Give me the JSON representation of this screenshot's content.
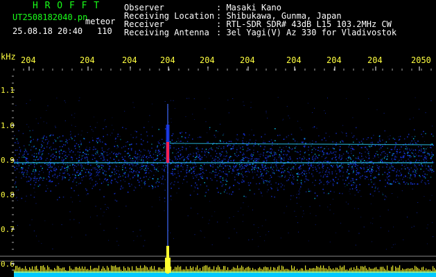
{
  "header": {
    "brand": "H R O F F T",
    "file_name": "UT2508182040.pn",
    "mode": "meteor",
    "datetime": "25.08.18 20:40",
    "count": "110"
  },
  "info": {
    "labels": [
      "Observer",
      "Receiving Location",
      "Receiver",
      "Receiving Antenna"
    ],
    "values": [
      ": Masaki Kano",
      ": Shibukawa, Gunma, Japan",
      ": RTL-SDR SDR# 43dB L15 103.2MHz CW",
      ": 3el Yagi(V) Az 330 for Vladivostok"
    ]
  },
  "time_axis": {
    "ticks": [
      "204",
      "204",
      "204",
      "204",
      "204",
      "204",
      "204",
      "204",
      "204",
      "2050"
    ]
  },
  "freq_axis": {
    "unit": "kHz",
    "ticks": [
      "1.1",
      "1.0",
      "0.9",
      "0.8",
      "0.7",
      "0.6"
    ]
  },
  "colors": {
    "background": "#000000",
    "header_green": "#19ff19",
    "tick_yellow": "#ffff40",
    "noise_blue": "#1a3cff",
    "meteor_red": "#ff2050",
    "baseline_cyan": "#00c8ff"
  }
}
